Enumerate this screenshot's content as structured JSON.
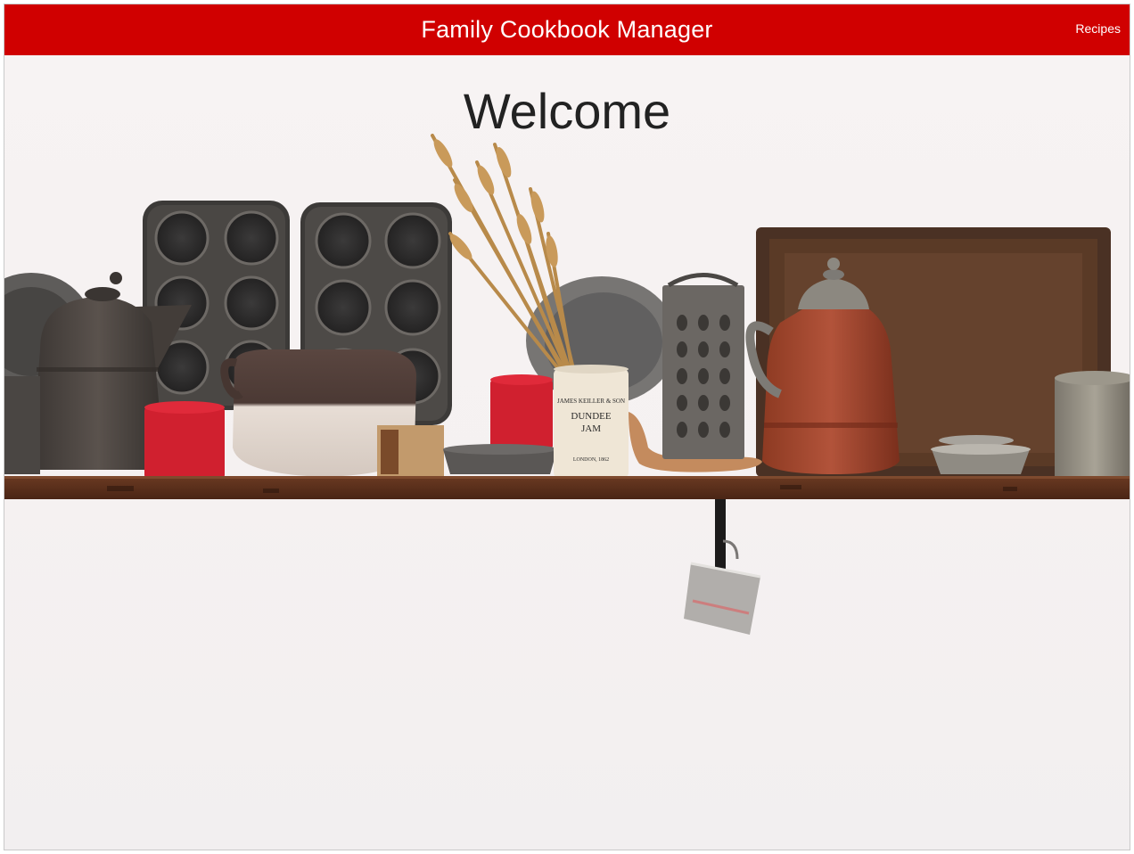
{
  "navbar": {
    "title": "Family Cookbook Manager",
    "recipes_link": "Recipes",
    "color": "#d00000"
  },
  "main": {
    "heading": "Welcome"
  },
  "hero_image": {
    "jar_label": [
      "JAMES KEILLER & SON",
      "DUNDEE",
      "JAM",
      "LONDON, 1862"
    ]
  }
}
